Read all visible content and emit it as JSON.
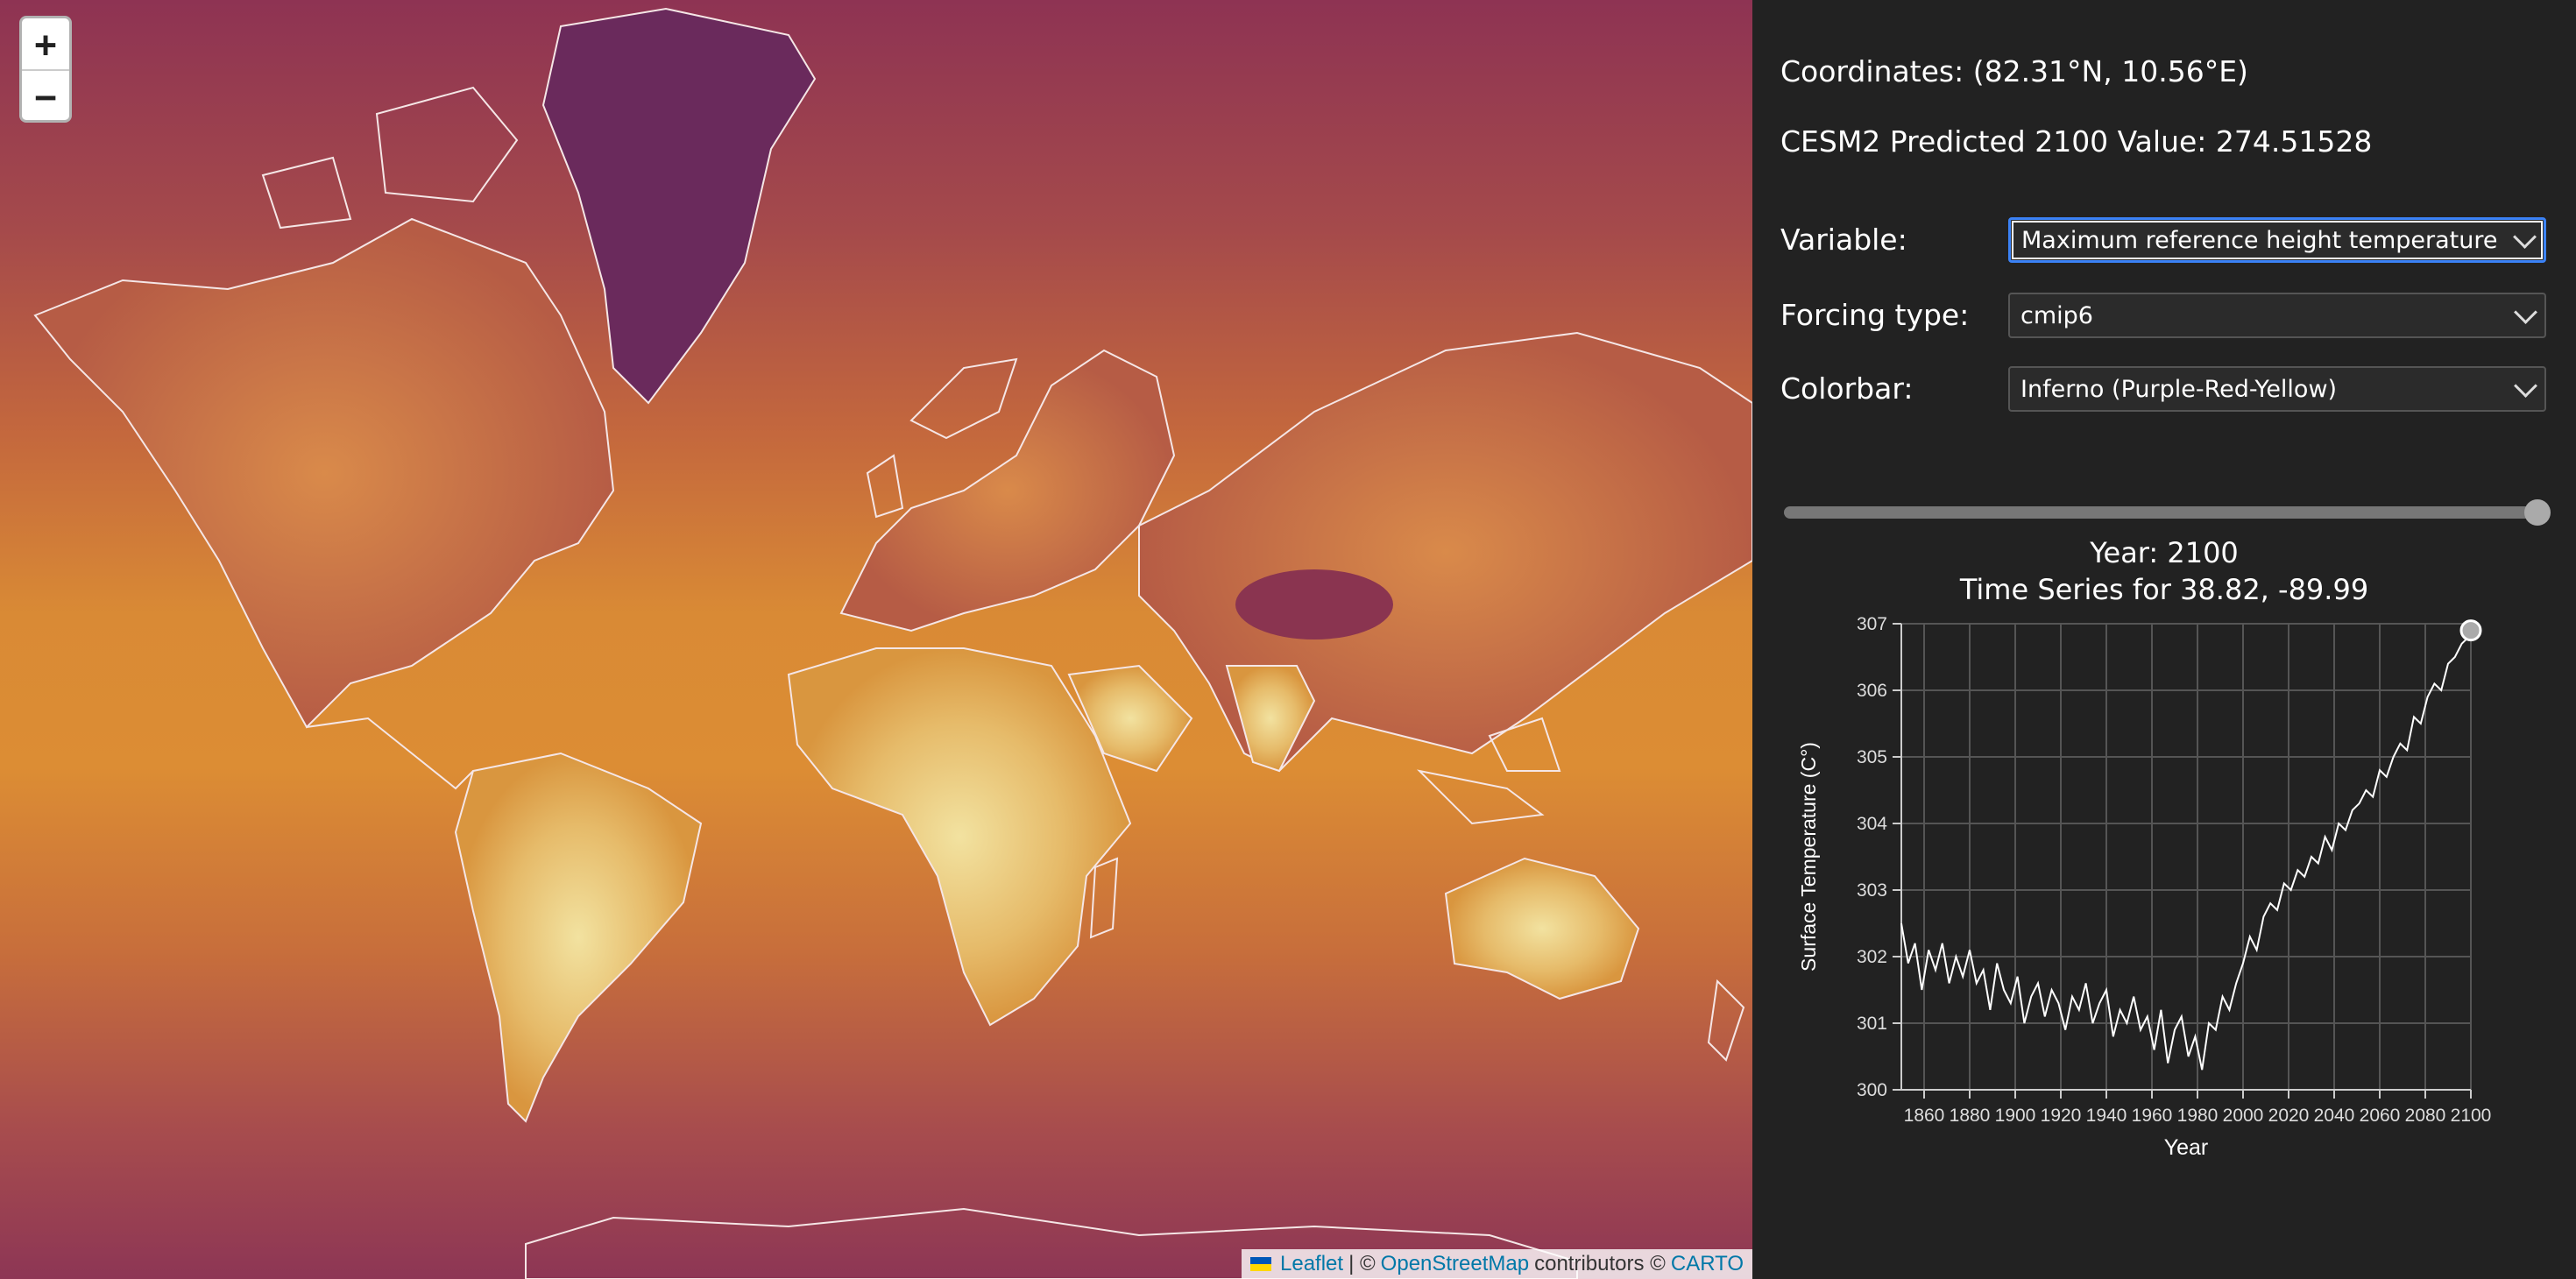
{
  "map": {
    "zoom_in": "+",
    "zoom_out": "−",
    "attribution": {
      "leaflet": "Leaflet",
      "sep1": "| ©",
      "osm": "OpenStreetMap",
      "contributors": "contributors ©",
      "carto": "CARTO"
    }
  },
  "panel": {
    "coordinates": "Coordinates: (82.31°N, 10.56°E)",
    "predicted": "CESM2 Predicted 2100 Value: 274.51528",
    "variable_label": "Variable:",
    "variable_value": "Maximum reference height temperature",
    "forcing_label": "Forcing type:",
    "forcing_value": "cmip6",
    "colorbar_label": "Colorbar:",
    "colorbar_value": "Inferno (Purple-Red-Yellow)",
    "slider_fraction": 1.0,
    "year_text": "Year: 2100",
    "series_title": "Time Series for 38.82, -89.99"
  },
  "chart_data": {
    "type": "line",
    "xlabel": "Year",
    "ylabel": "Surface Temperature (C°)",
    "xlim": [
      1850,
      2100
    ],
    "ylim": [
      300,
      307
    ],
    "x_ticks": [
      1860,
      1880,
      1900,
      1920,
      1940,
      1960,
      1980,
      2000,
      2020,
      2040,
      2060,
      2080,
      2100
    ],
    "y_ticks": [
      300,
      301,
      302,
      303,
      304,
      305,
      306,
      307
    ],
    "grid": true,
    "highlight_point": [
      2100,
      306.9
    ],
    "series": [
      {
        "x": [
          1850,
          1853,
          1856,
          1859,
          1862,
          1865,
          1868,
          1871,
          1874,
          1877,
          1880,
          1883,
          1886,
          1889,
          1892,
          1895,
          1898,
          1901,
          1904,
          1907,
          1910,
          1913,
          1916,
          1919,
          1922,
          1925,
          1928,
          1931,
          1934,
          1937,
          1940,
          1943,
          1946,
          1949,
          1952,
          1955,
          1958,
          1961,
          1964,
          1967,
          1970,
          1973,
          1976,
          1979,
          1982,
          1985,
          1988,
          1991,
          1994,
          1997,
          2000,
          2003,
          2006,
          2009,
          2012,
          2015,
          2018,
          2021,
          2024,
          2027,
          2030,
          2033,
          2036,
          2039,
          2042,
          2045,
          2048,
          2051,
          2054,
          2057,
          2060,
          2063,
          2066,
          2069,
          2072,
          2075,
          2078,
          2081,
          2084,
          2087,
          2090,
          2093,
          2096,
          2099,
          2100
        ],
        "y": [
          302.5,
          301.9,
          302.2,
          301.5,
          302.1,
          301.8,
          302.2,
          301.6,
          302.0,
          301.7,
          302.1,
          301.6,
          301.8,
          301.2,
          301.9,
          301.5,
          301.3,
          301.7,
          301.0,
          301.4,
          301.6,
          301.1,
          301.5,
          301.3,
          300.9,
          301.4,
          301.2,
          301.6,
          301.0,
          301.3,
          301.5,
          300.8,
          301.2,
          301.0,
          301.4,
          300.9,
          301.1,
          300.6,
          301.2,
          300.4,
          300.9,
          301.1,
          300.5,
          300.8,
          300.3,
          301.0,
          300.9,
          301.4,
          301.2,
          301.6,
          301.9,
          302.3,
          302.1,
          302.6,
          302.8,
          302.7,
          303.1,
          303.0,
          303.3,
          303.2,
          303.5,
          303.4,
          303.8,
          303.6,
          304.0,
          303.9,
          304.2,
          304.3,
          304.5,
          304.4,
          304.8,
          304.7,
          305.0,
          305.2,
          305.1,
          305.6,
          305.5,
          305.9,
          306.1,
          306.0,
          306.4,
          306.5,
          306.7,
          306.8,
          306.9
        ]
      }
    ]
  }
}
